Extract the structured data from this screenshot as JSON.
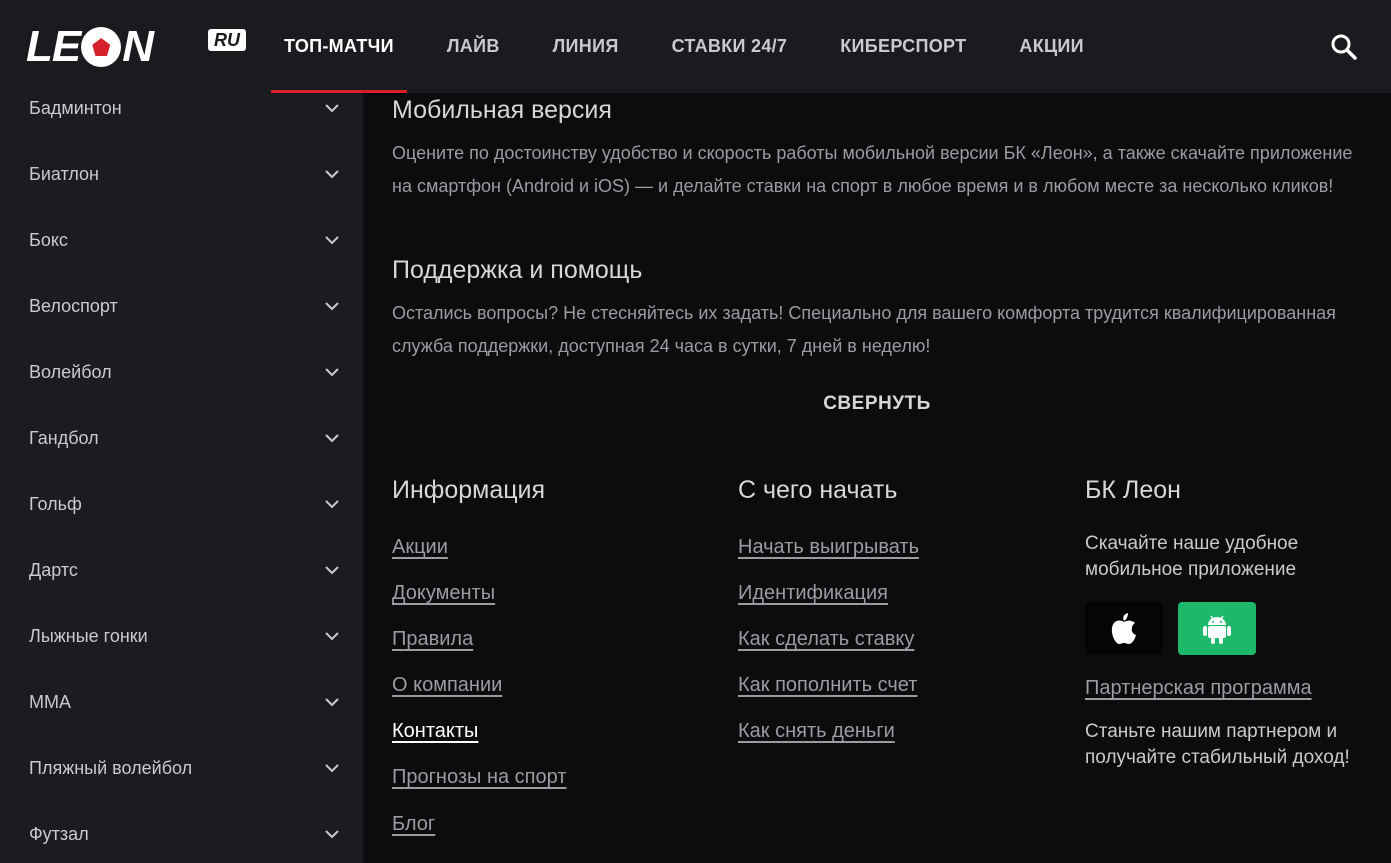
{
  "header": {
    "logo_text_1": "LE",
    "logo_text_2": "N",
    "logo_badge": "RU",
    "nav": [
      {
        "label": "ТОП-МАТЧИ",
        "active": true
      },
      {
        "label": "ЛАЙВ"
      },
      {
        "label": "ЛИНИЯ"
      },
      {
        "label": "СТАВКИ 24/7"
      },
      {
        "label": "КИБЕРСПОРТ"
      },
      {
        "label": "АКЦИИ"
      }
    ],
    "search_icon": "search-icon",
    "accent_color": "#d6202c"
  },
  "sidebar": {
    "items": [
      {
        "label": "Бадминтон"
      },
      {
        "label": "Биатлон"
      },
      {
        "label": "Бокс"
      },
      {
        "label": "Велоспорт"
      },
      {
        "label": "Волейбол"
      },
      {
        "label": "Гандбол"
      },
      {
        "label": "Гольф"
      },
      {
        "label": "Дартс"
      },
      {
        "label": "Лыжные гонки"
      },
      {
        "label": "MMA"
      },
      {
        "label": "Пляжный волейбол"
      },
      {
        "label": "Футзал"
      }
    ]
  },
  "main": {
    "mobile_title": "Мобильная версия",
    "mobile_text": "Оцените по достоинству удобство и скорость работы мобильной версии БК «Леон», а также скачайте приложение на смартфон (Android и iOS) — и делайте ставки на спорт в любое время и в любом месте за несколько кликов!",
    "support_title": "Поддержка и помощь",
    "support_text": "Остались вопросы? Не стесняйтесь их задать! Специально для вашего комфорта трудится квалифицированная служба поддержки, доступная 24 часа в сутки, 7 дней в неделю!",
    "collapse_label": "СВЕРНУТЬ"
  },
  "footer": {
    "info": {
      "title": "Информация",
      "links": [
        {
          "label": "Акции"
        },
        {
          "label": "Документы"
        },
        {
          "label": "Правила"
        },
        {
          "label": "О компании"
        },
        {
          "label": "Контакты",
          "active": true
        },
        {
          "label": "Прогнозы на спорт"
        },
        {
          "label": "Блог"
        }
      ]
    },
    "start": {
      "title": "С чего начать",
      "links": [
        {
          "label": "Начать выигрывать"
        },
        {
          "label": "Идентификация"
        },
        {
          "label": "Как сделать ставку"
        },
        {
          "label": "Как пополнить счет"
        },
        {
          "label": "Как снять деньги"
        }
      ]
    },
    "bk": {
      "title": "БК Леон",
      "app_text": "Скачайте наше удобное мобильное приложение",
      "partner_link": "Партнерская программа",
      "partner_text": "Станьте нашим партнером и получайте стабильный доход!",
      "android_color": "#1db86a"
    }
  }
}
